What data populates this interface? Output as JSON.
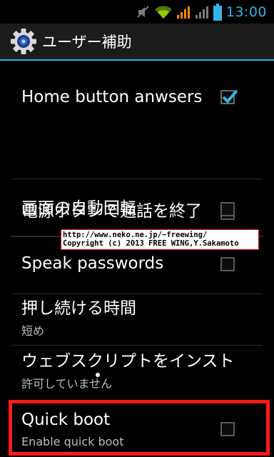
{
  "status_bar": {
    "time": "13:00",
    "icons": [
      "mute-icon",
      "wifi-icon",
      "signal-icon",
      "signal-icon-2",
      "battery-icon"
    ],
    "accent": "#33b5e5",
    "signal_color": "#ff8800"
  },
  "action_bar": {
    "title": "ユーザー補助",
    "icon": "gear-icon",
    "accent": "#33b5e5"
  },
  "settings": [
    {
      "label": "Home button anwsers c",
      "checked": true
    },
    {
      "label": "電源ボタンで通話を終了",
      "checked": false
    },
    {
      "label": "画面の自動回転",
      "checked": false
    },
    {
      "label": "Speak passwords",
      "checked": false
    },
    {
      "label": "押し続ける時間",
      "summary": "短め"
    },
    {
      "label": "ウェブスクリプトをインスト",
      "summary": "許可していません"
    },
    {
      "label": "Quick boot",
      "summary": "Enable quick boot",
      "checked": false
    }
  ],
  "watermark": {
    "line1": "http://www.neko.ne.jp/~freewing/",
    "line2": "Copyright (c) 2013 FREE WING,Y.Sakamoto"
  }
}
